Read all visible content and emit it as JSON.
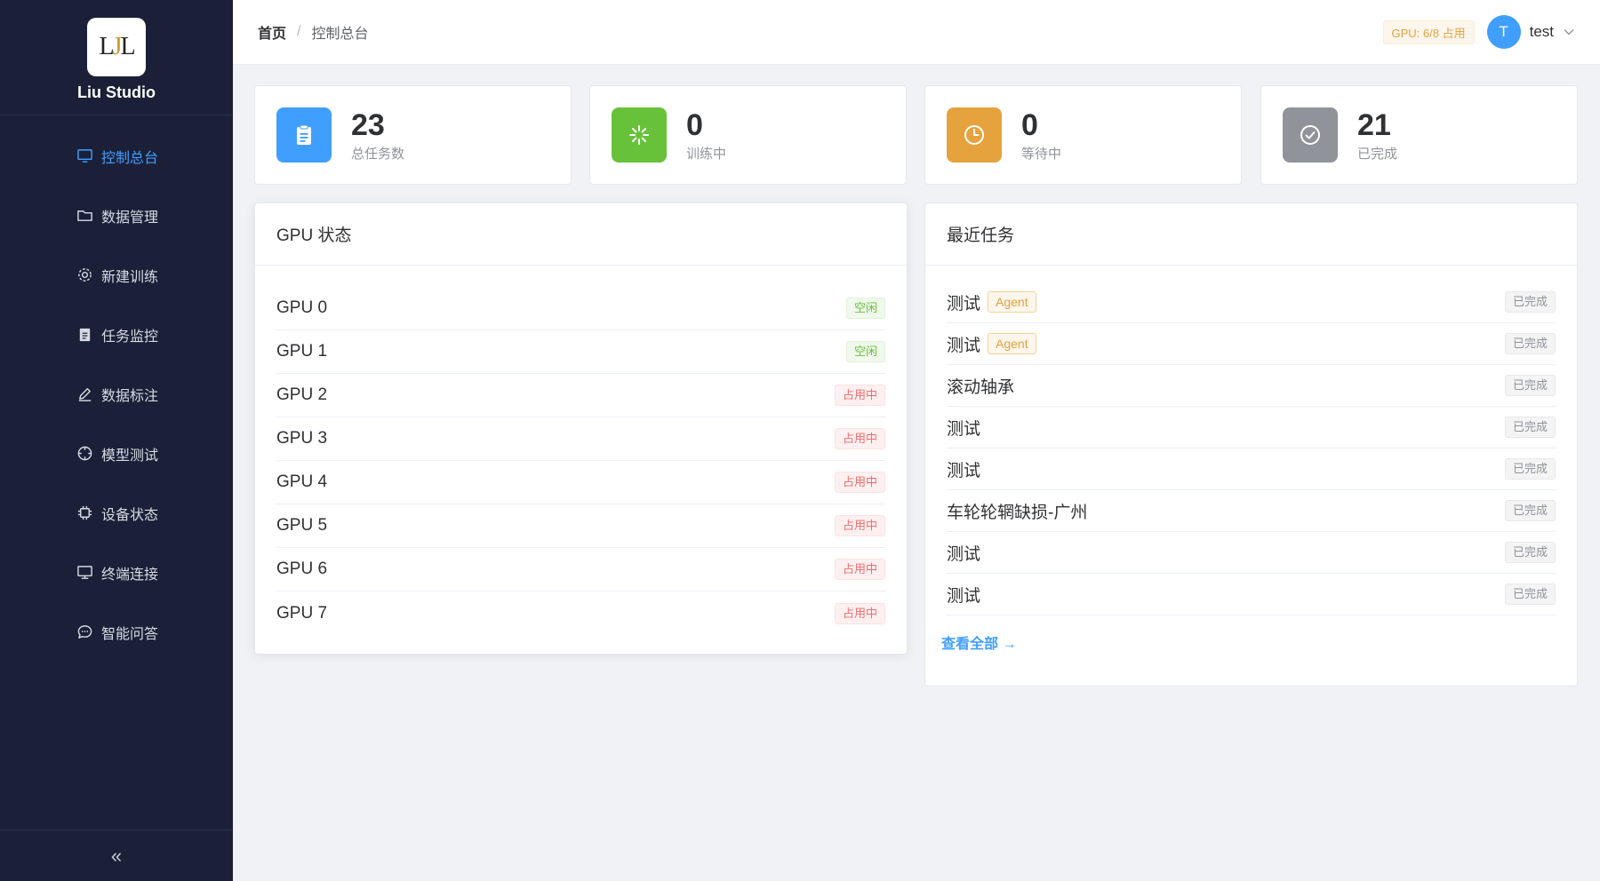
{
  "brand": {
    "logo_text": "LJL",
    "name": "Liu Studio"
  },
  "sidebar": {
    "items": [
      {
        "label": "控制总台",
        "icon": "monitor-icon",
        "active": true
      },
      {
        "label": "数据管理",
        "icon": "folder-icon"
      },
      {
        "label": "新建训练",
        "icon": "gear-icon"
      },
      {
        "label": "任务监控",
        "icon": "clipboard-icon"
      },
      {
        "label": "数据标注",
        "icon": "pen-icon"
      },
      {
        "label": "模型测试",
        "icon": "compass-icon"
      },
      {
        "label": "设备状态",
        "icon": "chip-icon"
      },
      {
        "label": "终端连接",
        "icon": "desktop-icon"
      },
      {
        "label": "智能问答",
        "icon": "chat-icon"
      }
    ],
    "collapse_glyph": "«"
  },
  "header": {
    "breadcrumb": {
      "home": "首页",
      "separator": "/",
      "current": "控制总台"
    },
    "gpu_badge": "GPU: 6/8 占用",
    "avatar_letter": "T",
    "username": "test"
  },
  "stats": [
    {
      "value": "23",
      "label": "总任务数",
      "color": "#409eff",
      "icon": "clipboard-icon"
    },
    {
      "value": "0",
      "label": "训练中",
      "color": "#67c23a",
      "icon": "loading-icon"
    },
    {
      "value": "0",
      "label": "等待中",
      "color": "#e6a23c",
      "icon": "clock-icon"
    },
    {
      "value": "21",
      "label": "已完成",
      "color": "#909399",
      "icon": "check-circle-icon"
    }
  ],
  "gpu_panel": {
    "title": "GPU 状态",
    "gpus": [
      {
        "name": "GPU 0",
        "status": "空闲",
        "state": "free"
      },
      {
        "name": "GPU 1",
        "status": "空闲",
        "state": "free"
      },
      {
        "name": "GPU 2",
        "status": "占用中",
        "state": "busy"
      },
      {
        "name": "GPU 3",
        "status": "占用中",
        "state": "busy"
      },
      {
        "name": "GPU 4",
        "status": "占用中",
        "state": "busy"
      },
      {
        "name": "GPU 5",
        "status": "占用中",
        "state": "busy"
      },
      {
        "name": "GPU 6",
        "status": "占用中",
        "state": "busy"
      },
      {
        "name": "GPU 7",
        "status": "占用中",
        "state": "busy"
      }
    ]
  },
  "task_panel": {
    "title": "最近任务",
    "tasks": [
      {
        "name": "测试",
        "tag": "Agent",
        "status": "已完成"
      },
      {
        "name": "测试",
        "tag": "Agent",
        "status": "已完成"
      },
      {
        "name": "滚动轴承",
        "tag": "",
        "status": "已完成"
      },
      {
        "name": "测试",
        "tag": "",
        "status": "已完成"
      },
      {
        "name": "测试",
        "tag": "",
        "status": "已完成"
      },
      {
        "name": "车轮轮辋缺损-广州",
        "tag": "",
        "status": "已完成"
      },
      {
        "name": "测试",
        "tag": "",
        "status": "已完成"
      },
      {
        "name": "测试",
        "tag": "",
        "status": "已完成"
      }
    ],
    "view_all": "查看全部 →"
  }
}
